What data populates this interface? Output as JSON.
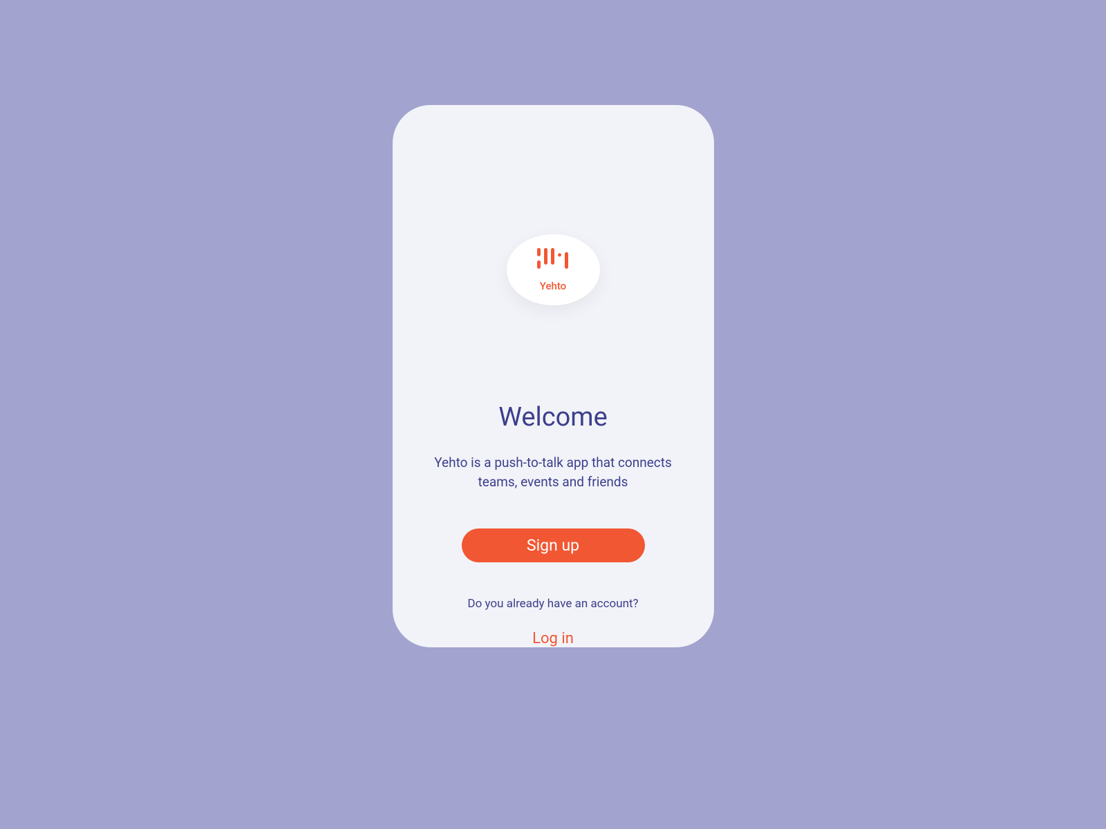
{
  "logo": {
    "name": "Yehto"
  },
  "welcome": {
    "heading": "Welcome",
    "description": "Yehto is a push-to-talk app that connects teams, events and friends"
  },
  "actions": {
    "signup_label": "Sign up",
    "account_prompt": "Do you already have an account?",
    "login_label": "Log in"
  },
  "colors": {
    "background": "#a2a3ce",
    "card": "#f2f3f8",
    "accent": "#f15733",
    "text_primary": "#3c3e8c"
  }
}
